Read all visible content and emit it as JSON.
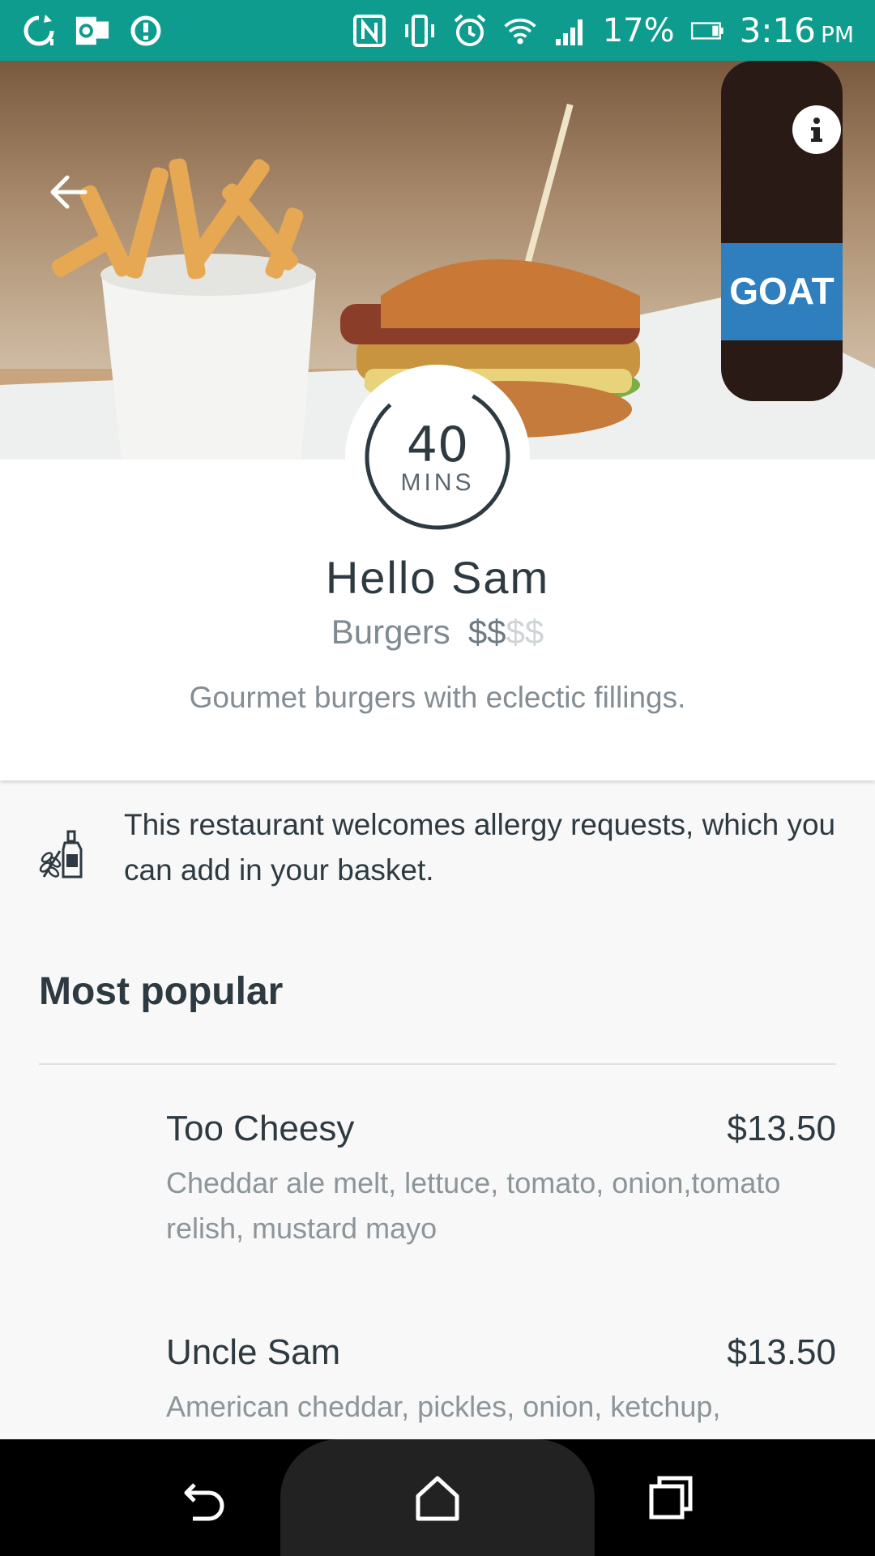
{
  "status_bar": {
    "battery": "17%",
    "time": "3:16",
    "ampm": "PM"
  },
  "timer": {
    "value": "40",
    "unit": "MINS"
  },
  "restaurant": {
    "title": "Hello Sam",
    "category": "Burgers",
    "price_active": "$$",
    "price_inactive": "$$",
    "description": "Gourmet burgers with eclectic fillings."
  },
  "allergy": {
    "text": "This restaurant welcomes allergy requests, which you can add in your basket."
  },
  "section": {
    "title": "Most popular"
  },
  "menu_items": [
    {
      "name": "Too Cheesy",
      "price": "$13.50",
      "description": "Cheddar ale melt, lettuce, tomato, onion,tomato relish, mustard mayo"
    },
    {
      "name": "Uncle Sam",
      "price": "$13.50",
      "description": "American cheddar, pickles, onion, ketchup,"
    }
  ],
  "hero_label": "GOAT",
  "colors": {
    "status_bar": "#0e9c8e",
    "text": "#2e3a41",
    "muted": "#838d93"
  }
}
